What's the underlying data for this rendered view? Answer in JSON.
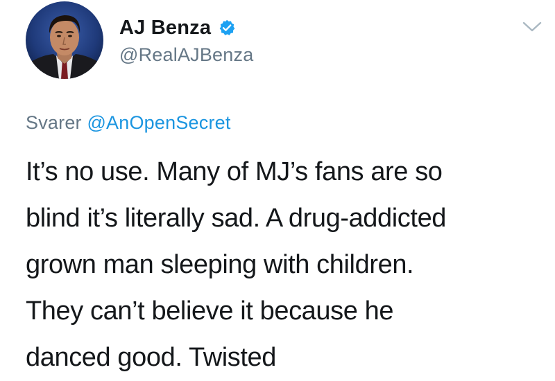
{
  "tweet": {
    "author": {
      "display_name": "AJ Benza",
      "handle": "@RealAJBenza",
      "verified": true
    },
    "reply_context": {
      "prefix": "Svarer",
      "mention": "@AnOpenSecret"
    },
    "text_lines": [
      "It’s no use. Many of MJ’s fans are so",
      "blind it’s literally sad. A drug-addicted",
      "grown man sleeping with children.",
      "They can’t believe it because he",
      "danced good. Twisted"
    ]
  },
  "icons": {
    "verified": "verified-badge-icon",
    "menu": "chevron-down-icon"
  },
  "colors": {
    "text_primary": "#14171a",
    "text_secondary": "#657786",
    "link": "#1b95e0",
    "verified_badge": "#1da1f2",
    "chevron": "#aab8c2"
  }
}
